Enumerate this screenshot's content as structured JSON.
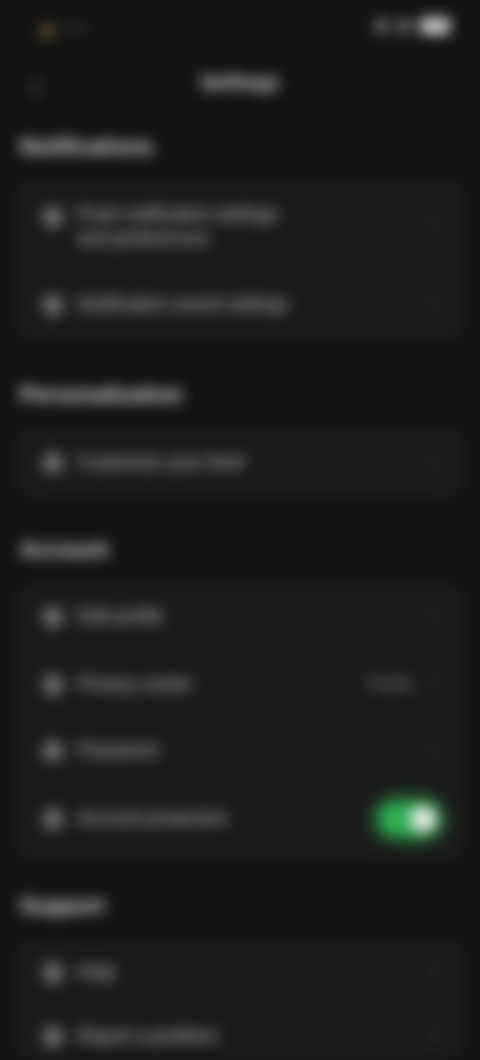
{
  "status_bar": {
    "left_text": "•  • •",
    "right_glyphs": [
      "signal",
      "wifi",
      "battery"
    ]
  },
  "header": {
    "title": "Settings",
    "back_icon": "back-arrow-icon"
  },
  "sections": [
    {
      "title": "Notifications",
      "items": [
        {
          "label": "Push notification settings and preferences",
          "type": "chevron"
        },
        {
          "label": "Notification sound settings",
          "type": "chevron"
        }
      ]
    },
    {
      "title": "Personalization",
      "items": [
        {
          "label": "Customize your feed",
          "type": "chevron"
        }
      ]
    },
    {
      "title": "Account",
      "items": [
        {
          "label": "Edit profile",
          "type": "chevron"
        },
        {
          "label": "Privacy center",
          "value": "Public",
          "type": "value"
        },
        {
          "label": "Password",
          "type": "chevron"
        },
        {
          "label": "Account protection",
          "type": "toggle",
          "on": true
        }
      ]
    },
    {
      "title": "Support",
      "items": [
        {
          "label": "Help",
          "type": "chevron"
        },
        {
          "label": "Report a problem",
          "type": "chevron"
        }
      ]
    }
  ],
  "colors": {
    "background": "#141414",
    "card": "#1c1c1c",
    "toggle_on": "#2fae52"
  }
}
